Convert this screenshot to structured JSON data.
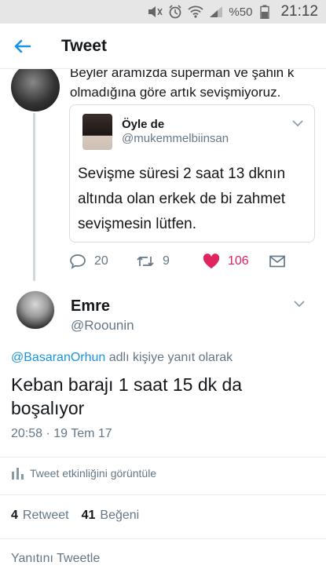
{
  "status_bar": {
    "battery_text": "%50",
    "time": "21:12",
    "icons": [
      "mute-icon",
      "alarm-icon",
      "wifi-icon",
      "signal-icon",
      "battery-icon"
    ]
  },
  "header": {
    "title": "Tweet",
    "back_icon": "arrow-left-icon"
  },
  "parent_tweet": {
    "text": "Beyler aramızda süperman ve şahin k olmadığına göre artık sevişmiyoruz.",
    "quoted_tweet": {
      "name": "Öyle de",
      "handle": "@mukemmelbiinsan",
      "text": "Sevişme süresi 2 saat 13 dknın altında olan erkek de bi zahmet sevişmesin lütfen."
    },
    "actions": {
      "replies": "20",
      "retweets": "9",
      "likes": "106"
    }
  },
  "reply_tweet": {
    "name": "Emre",
    "handle": "@Roounin",
    "replying_to_handle": "@BasaranOrhun",
    "replying_to_suffix": " adlı kişiye yanıt olarak",
    "text": "Keban barajı 1 saat 15 dk da boşalıyor",
    "timestamp": "20:58 · 19 Tem 17",
    "activity_label": "Tweet etkinliğini görüntüle",
    "retweet_count": "4",
    "retweet_label": "Retweet",
    "like_count": "41",
    "like_label": "Beğeni",
    "reply_placeholder": "Yanıtını Tweetle"
  },
  "colors": {
    "accent": "#1b95e0",
    "like": "#e0245e",
    "secondary_text": "#657786"
  }
}
